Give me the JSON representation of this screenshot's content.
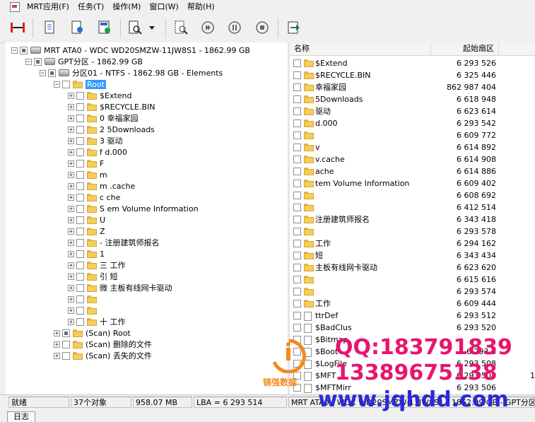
{
  "menubar": {
    "items": [
      "MRT应用(F)",
      "任务(T)",
      "操作(M)",
      "窗口(W)",
      "帮助(H)"
    ]
  },
  "toolbar": {
    "buttons": [
      "disk-connect",
      "report",
      "view-report",
      "view-report-detail",
      "search",
      "dropdown",
      "scan",
      "step",
      "pause",
      "stop",
      "export"
    ]
  },
  "tree": {
    "nodes": [
      {
        "label": "MRT ATA0 - WDC WD20SMZW-11JW8S1 - 1862.99 GB",
        "icon": "disk",
        "level": 0,
        "expander": "-",
        "check": "partial"
      },
      {
        "label": "GPT分区 - 1862.99 GB",
        "icon": "disk",
        "level": 1,
        "expander": "-",
        "check": "partial"
      },
      {
        "label": "分区01 - NTFS - 1862.98 GB - Elements",
        "icon": "disk",
        "level": 2,
        "expander": "-",
        "check": "partial"
      },
      {
        "label": "Root",
        "icon": "folder",
        "level": 3,
        "expander": "-",
        "check": "none",
        "selected": true
      },
      {
        "label": "$Extend",
        "icon": "folder",
        "level": 4,
        "expander": "+",
        "check": "none"
      },
      {
        "label": "$RECYCLE.BIN",
        "icon": "folder",
        "level": 4,
        "expander": "+",
        "check": "none"
      },
      {
        "label": "0  幸福家园",
        "icon": "folder",
        "level": 4,
        "expander": "+",
        "check": "none"
      },
      {
        "label": "2  5Downloads",
        "icon": "folder",
        "level": 4,
        "expander": "+",
        "check": "none"
      },
      {
        "label": "3  驱动",
        "icon": "folder",
        "level": 4,
        "expander": "+",
        "check": "none"
      },
      {
        "label": "f   d.000",
        "icon": "folder",
        "level": 4,
        "expander": "+",
        "check": "none"
      },
      {
        "label": "F",
        "icon": "folder",
        "level": 4,
        "expander": "+",
        "check": "none"
      },
      {
        "label": "m",
        "icon": "folder",
        "level": 4,
        "expander": "+",
        "check": "none"
      },
      {
        "label": "m   .cache",
        "icon": "folder",
        "level": 4,
        "expander": "+",
        "check": "none"
      },
      {
        "label": "c   che",
        "icon": "folder",
        "level": 4,
        "expander": "+",
        "check": "none"
      },
      {
        "label": "S   em Volume Information",
        "icon": "folder",
        "level": 4,
        "expander": "+",
        "check": "none"
      },
      {
        "label": "U",
        "icon": "folder",
        "level": 4,
        "expander": "+",
        "check": "none"
      },
      {
        "label": "Z",
        "icon": "folder",
        "level": 4,
        "expander": "+",
        "check": "none"
      },
      {
        "label": "-   注册建筑师报名",
        "icon": "folder",
        "level": 4,
        "expander": "+",
        "check": "none"
      },
      {
        "label": "1",
        "icon": "folder",
        "level": 4,
        "expander": "+",
        "check": "none"
      },
      {
        "label": "三   工作",
        "icon": "folder",
        "level": 4,
        "expander": "+",
        "check": "none"
      },
      {
        "label": "引   短",
        "icon": "folder",
        "level": 4,
        "expander": "+",
        "check": "none"
      },
      {
        "label": "微   主板有线网卡驱动",
        "icon": "folder",
        "level": 4,
        "expander": "+",
        "check": "none"
      },
      {
        "label": " ",
        "icon": "folder",
        "level": 4,
        "expander": "+",
        "check": "none"
      },
      {
        "label": " ",
        "icon": "folder",
        "level": 4,
        "expander": "+",
        "check": "none"
      },
      {
        "label": "十   工作",
        "icon": "folder",
        "level": 4,
        "expander": "+",
        "check": "none"
      },
      {
        "label": "(Scan) Root",
        "icon": "folder",
        "level": 3,
        "expander": "+",
        "check": "partial"
      },
      {
        "label": "(Scan) 删除的文件",
        "icon": "folder",
        "level": 3,
        "expander": "+",
        "check": "none"
      },
      {
        "label": "(Scan) 丢失的文件",
        "icon": "folder",
        "level": 3,
        "expander": "+",
        "check": "none"
      }
    ]
  },
  "list": {
    "headers": {
      "name": "名称",
      "sector": "起始扇区"
    },
    "rows": [
      {
        "name": "$Extend",
        "sector": "6 293 526",
        "icon": "folder"
      },
      {
        "name": "$RECYCLE.BIN",
        "sector": "6 325 446",
        "icon": "folder"
      },
      {
        "name": "幸福家园",
        "sector": "862 987 404",
        "icon": "folder"
      },
      {
        "name": "5Downloads",
        "sector": "6 618 948",
        "icon": "folder"
      },
      {
        "name": "驱动",
        "sector": "6 623 614",
        "icon": "folder"
      },
      {
        "name": "d.000",
        "sector": "6 293 542",
        "icon": "folder"
      },
      {
        "name": "",
        "sector": "6 609 772",
        "icon": "folder"
      },
      {
        "name": "v",
        "sector": "6 614 892",
        "icon": "folder"
      },
      {
        "name": "v.cache",
        "sector": "6 614 908",
        "icon": "folder"
      },
      {
        "name": "ache",
        "sector": "6 614 886",
        "icon": "folder"
      },
      {
        "name": "tem Volume Information",
        "sector": "6 609 402",
        "icon": "folder"
      },
      {
        "name": "",
        "sector": "6 608 692",
        "icon": "folder"
      },
      {
        "name": "",
        "sector": "6 412 514",
        "icon": "folder"
      },
      {
        "name": "注册建筑师报名",
        "sector": "6 343 418",
        "icon": "folder"
      },
      {
        "name": "",
        "sector": "6 293 578",
        "icon": "folder"
      },
      {
        "name": "工作",
        "sector": "6 294 162",
        "icon": "folder"
      },
      {
        "name": "短",
        "sector": "6 343 434",
        "icon": "folder"
      },
      {
        "name": "主板有线网卡驱动",
        "sector": "6 623 620",
        "icon": "folder"
      },
      {
        "name": "",
        "sector": "6 615 616",
        "icon": "folder"
      },
      {
        "name": "",
        "sector": "6 293 574",
        "icon": "folder"
      },
      {
        "name": "工作",
        "sector": "6 609 444",
        "icon": "folder"
      },
      {
        "name": "ttrDef",
        "sector": "6 293 512",
        "icon": "file"
      },
      {
        "name": "$BadClus",
        "sector": "6 293 520",
        "icon": "file"
      },
      {
        "name": "$Bitmap",
        "sector": "",
        "icon": "file"
      },
      {
        "name": "$Boot",
        "sector": "6 293 5",
        "icon": "file"
      },
      {
        "name": "$LogFile",
        "sector": "6 293 508",
        "icon": "file"
      },
      {
        "name": "$MFT",
        "sector": "6 293 504",
        "icon": "file",
        "extra": "1"
      },
      {
        "name": "$MFTMirr",
        "sector": "6 293 506",
        "icon": "file"
      }
    ]
  },
  "status": {
    "ready": "就绪",
    "objects": "37个对象",
    "size": "958.07 MB",
    "lba": "LBA = 6 293 514",
    "device": "MRT ATA0 - WDC WD20SMZW-11JW8S1 - 1862.99 GB - GPT分区"
  },
  "bottom": {
    "tab": "日志"
  },
  "watermark": {
    "qq": "QQ:183791839",
    "phone": "13389675138",
    "site": "www.jqhdd.com",
    "brand": "锦强数据",
    "colors": {
      "qq": "#e8156f",
      "site": "#2a2ad6",
      "logo": "#f28a1e"
    }
  }
}
